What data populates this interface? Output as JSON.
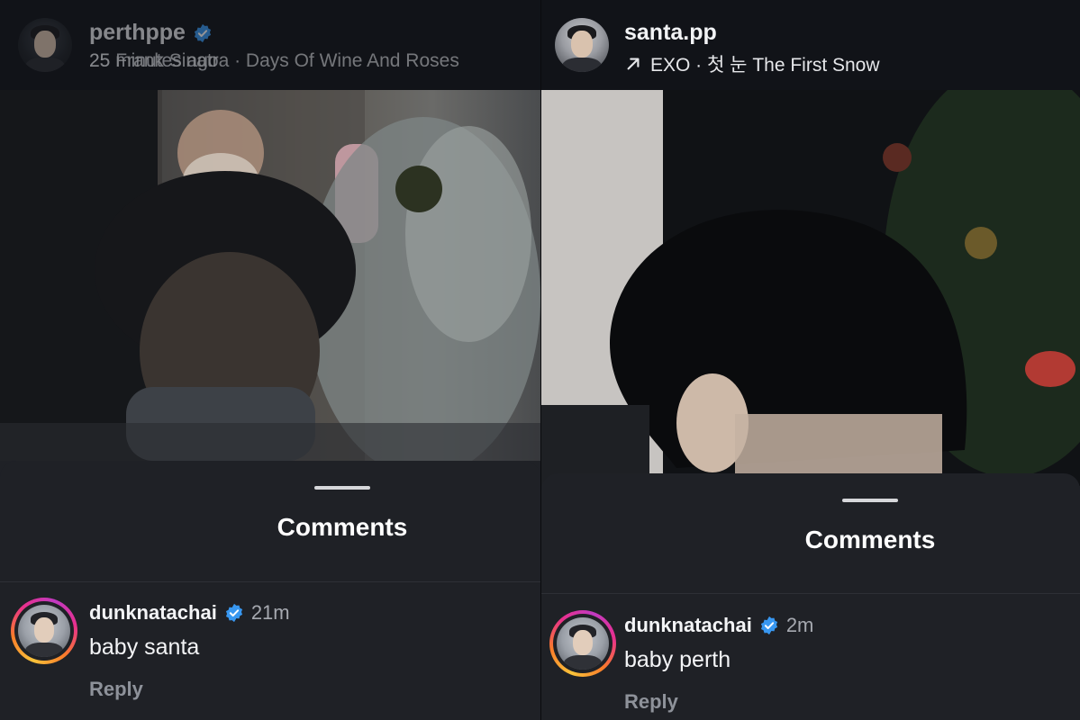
{
  "colors": {
    "verified": "#3897f0",
    "sheet_bg": "#1f2126",
    "header_bg": "#111318",
    "muted": "#8e929a"
  },
  "left": {
    "story": {
      "username": "perthppe",
      "subline_base": "25 minutes ago",
      "subline_overlay": "25 Frank Sinatra · Days Of Wine And Roses"
    },
    "sheet": {
      "title": "Comments",
      "comment": {
        "username": "dunknatachai",
        "time": "21m",
        "text": "baby santa",
        "reply_label": "Reply"
      }
    }
  },
  "right": {
    "story": {
      "username": "santa.pp",
      "music": "EXO · 첫 눈 The First Snow"
    },
    "sheet": {
      "title": "Comments",
      "comment": {
        "username": "dunknatachai",
        "time": "2m",
        "text": "baby perth",
        "reply_label": "Reply"
      }
    }
  },
  "icons": {
    "verified": "verified-badge-icon",
    "music": "arrow-up-right-icon"
  }
}
